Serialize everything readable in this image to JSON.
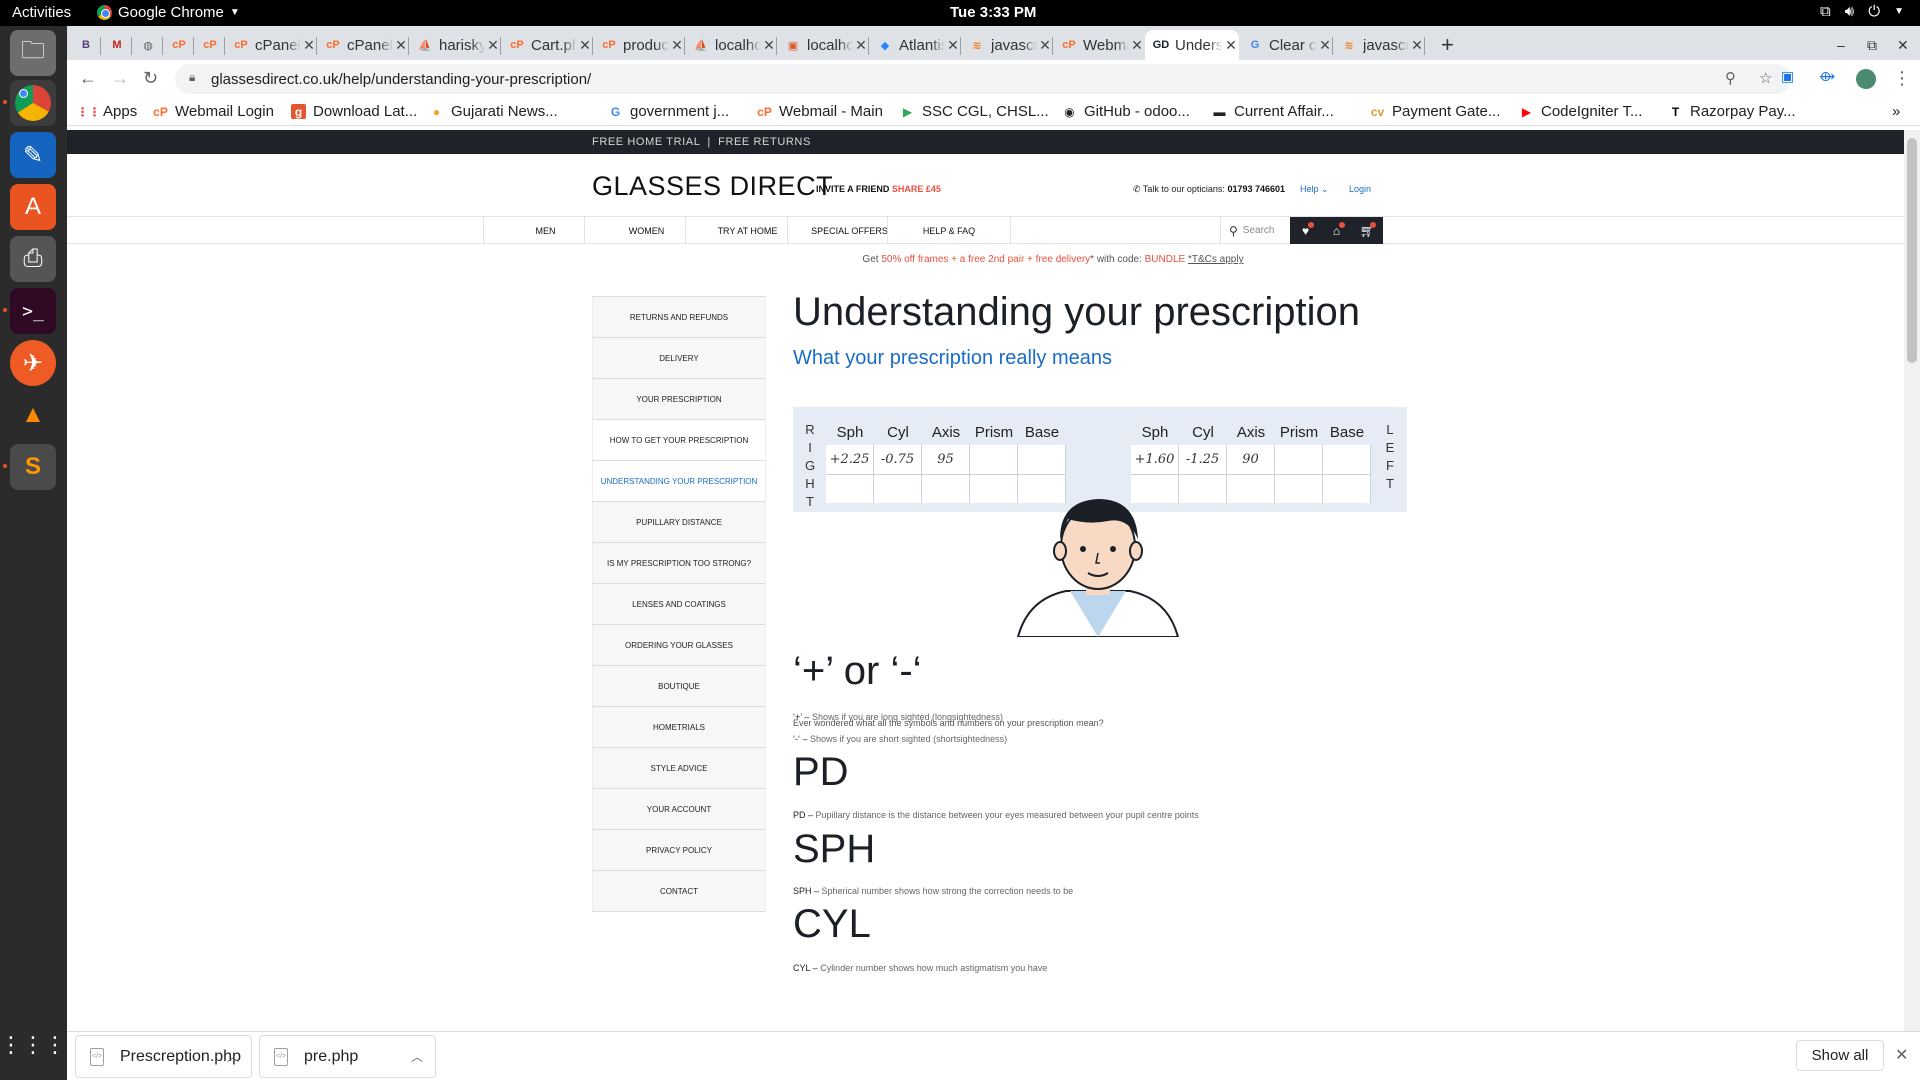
{
  "os": {
    "activities": "Activities",
    "app_name": "Google Chrome",
    "clock": "Tue  3:33 PM"
  },
  "tabs": [
    {
      "title": "",
      "icon": "B"
    },
    {
      "title": "",
      "icon": "M"
    },
    {
      "title": "",
      "icon": "globe"
    },
    {
      "title": "",
      "icon": "cP"
    },
    {
      "title": "",
      "icon": "cP"
    },
    {
      "title": "cPanel",
      "icon": "cP"
    },
    {
      "title": "cPanel",
      "icon": "cP"
    },
    {
      "title": "harisky",
      "icon": "pma"
    },
    {
      "title": "Cart.php",
      "icon": "cP"
    },
    {
      "title": "product",
      "icon": "cP"
    },
    {
      "title": "localhost",
      "icon": "pma"
    },
    {
      "title": "localhost",
      "icon": "pm"
    },
    {
      "title": "Atlantis",
      "icon": "atl"
    },
    {
      "title": "javascript",
      "icon": "so"
    },
    {
      "title": "Webmail",
      "icon": "cP"
    },
    {
      "title": "Understanding",
      "icon": "GD"
    },
    {
      "title": "Clear cache",
      "icon": "G"
    },
    {
      "title": "javascript",
      "icon": "so"
    }
  ],
  "toolbar": {
    "url": "glassesdirect.co.uk/help/understanding-your-prescription/"
  },
  "bookmarks": [
    {
      "label": "Apps",
      "icon": "apps"
    },
    {
      "label": "Webmail Login",
      "icon": "cP"
    },
    {
      "label": "Download Lat...",
      "icon": "g"
    },
    {
      "label": "Gujarati News...",
      "icon": "circle"
    },
    {
      "label": "government j...",
      "icon": "G"
    },
    {
      "label": "Webmail - Main",
      "icon": "cP"
    },
    {
      "label": "SSC CGL, CHSL...",
      "icon": "play"
    },
    {
      "label": "GitHub - odoo...",
      "icon": "github"
    },
    {
      "label": "Current Affair...",
      "icon": "ca"
    },
    {
      "label": "Payment Gate...",
      "icon": "cv"
    },
    {
      "label": "CodeIgniter T...",
      "icon": "yt"
    },
    {
      "label": "Razorpay Pay...",
      "icon": "T"
    }
  ],
  "site": {
    "strip_left": "FREE HOME TRIAL",
    "strip_right": "FREE RETURNS",
    "logo": "GLASSES DIRECT",
    "invite": "INVITE A FRIEND",
    "invite_share": "SHARE £45",
    "talk": "Talk to our opticians:",
    "phone": "01793 746601",
    "help": "Help",
    "login": "Login",
    "nav": [
      "MEN",
      "WOMEN",
      "TRY AT HOME",
      "SPECIAL OFFERS",
      "HELP & FAQ"
    ],
    "search_placeholder": "Search",
    "offer_get": "Get ",
    "offer_deal": "50% off frames + a free 2nd pair + free delivery",
    "offer_code_text": "* with code: ",
    "offer_code": "BUNDLE",
    "offer_tc": "*T&Cs apply"
  },
  "sidebar": [
    "RETURNS AND REFUNDS",
    "DELIVERY",
    "YOUR PRESCRIPTION",
    "HOW TO GET YOUR PRESCRIPTION",
    "UNDERSTANDING YOUR PRESCRIPTION",
    "PUPILLARY DISTANCE",
    "IS MY PRESCRIPTION TOO STRONG?",
    "LENSES AND COATINGS",
    "ORDERING YOUR GLASSES",
    "BOUTIQUE",
    "HOMETRIALS",
    "STYLE ADVICE",
    "YOUR ACCOUNT",
    "PRIVACY POLICY",
    "CONTACT"
  ],
  "content": {
    "title": "Understanding your prescription",
    "subtitle": "What your prescription really means",
    "rx": {
      "right_label": [
        "R",
        "I",
        "G",
        "H",
        "T"
      ],
      "left_label": [
        "L",
        "E",
        "F",
        "T"
      ],
      "headers": [
        "Sph",
        "Cyl",
        "Axis",
        "Prism",
        "Base"
      ],
      "right_values": [
        "+2.25",
        "-0.75",
        "95",
        "",
        ""
      ],
      "left_values": [
        "+1.60",
        "-1.25",
        "90",
        "",
        ""
      ]
    },
    "intro": "Ever wondered what all the symbols and numbers on your prescription mean?",
    "sections": [
      {
        "heading": "‘+’ or ‘-‘",
        "lines": [
          {
            "term": "‘+’ –",
            "text": " Shows if you are long sighted (longsightedness)"
          },
          {
            "term": "‘-‘ –",
            "text": " Shows if you are short sighted (shortsightedness)"
          }
        ]
      },
      {
        "heading": "PD",
        "lines": [
          {
            "term": "PD –",
            "text": " Pupillary distance is the distance between your eyes measured between your pupil centre points"
          }
        ]
      },
      {
        "heading": "SPH",
        "lines": [
          {
            "term": "SPH –",
            "text": " Spherical number shows how strong the correction needs to be"
          }
        ]
      },
      {
        "heading": "CYL",
        "lines": [
          {
            "term": "CYL –",
            "text": " Cylinder number shows how much astigmatism you have"
          }
        ]
      }
    ]
  },
  "downloads": {
    "files": [
      "Prescreption.php",
      "pre.php"
    ],
    "show_all": "Show all"
  }
}
